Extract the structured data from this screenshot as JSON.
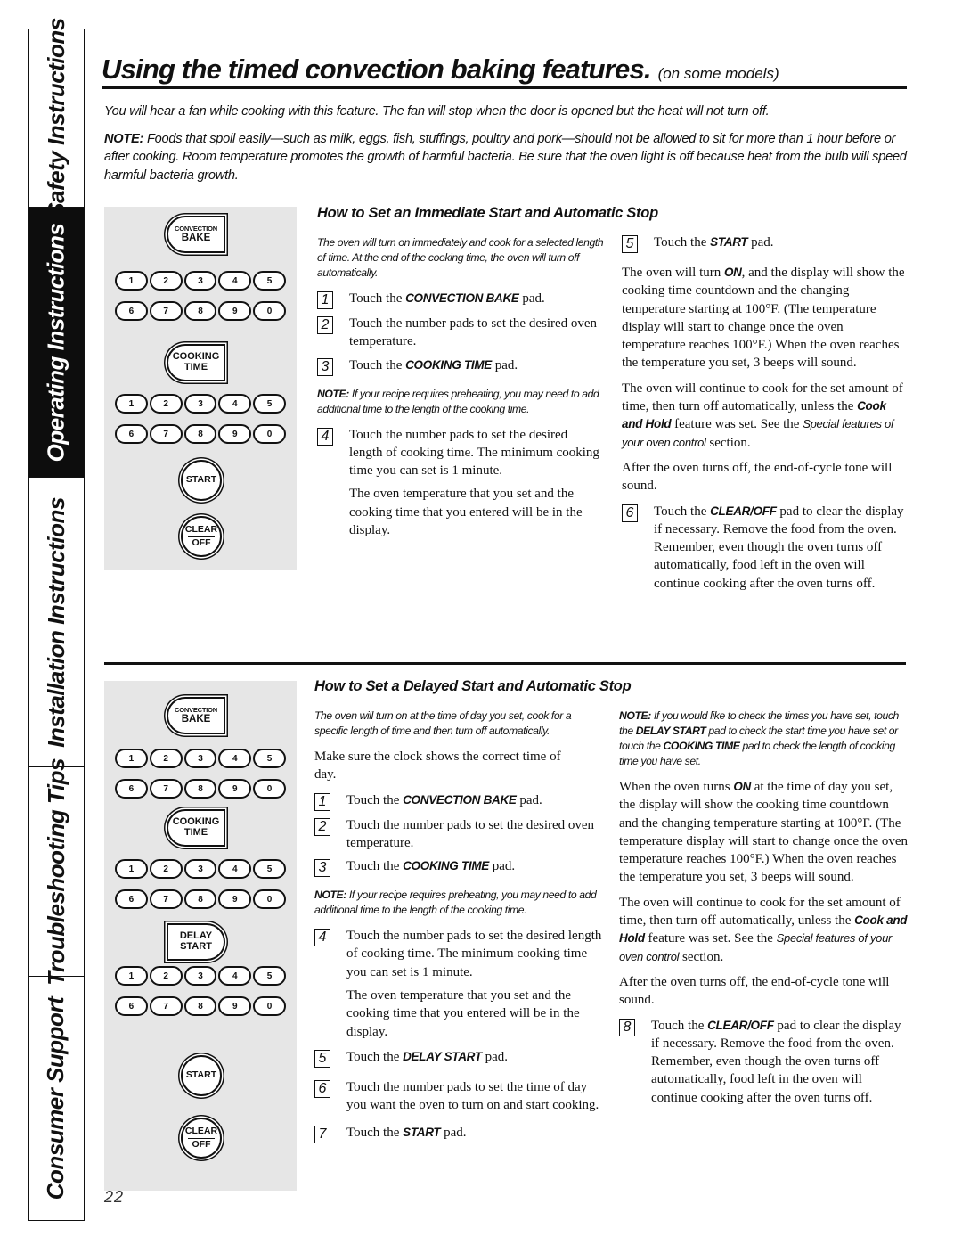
{
  "side_tabs": [
    {
      "label": "Safety Instructions",
      "active": false
    },
    {
      "label": "Operating Instructions",
      "active": true
    },
    {
      "label": "Installation Instructions",
      "active": false
    },
    {
      "label": "Troubleshooting Tips",
      "active": false
    },
    {
      "label": "Consumer Support",
      "active": false
    }
  ],
  "header": {
    "title": "Using the timed convection baking features.",
    "subtitle": "(on some models)"
  },
  "intro": {
    "fan_note": "You will hear a fan while cooking with this feature. The fan will stop when the door is opened but the heat will not turn off.",
    "note_label": "NOTE:",
    "note_text": " Foods that spoil easily—such as milk, eggs, fish, stuffings, poultry and pork—should not be allowed to sit for more than 1 hour before or after cooking. Room temperature promotes the growth of harmful bacteria. Be sure that the oven light is off because heat from the bulb will speed harmful bacteria growth."
  },
  "keypad": {
    "convection_small": "CONVECTION",
    "convection_big": "BAKE",
    "cooking_line1": "COOKING",
    "cooking_line2": "TIME",
    "delay_line1": "DELAY",
    "delay_line2": "START",
    "row1": [
      "1",
      "2",
      "3",
      "4",
      "5"
    ],
    "row2": [
      "6",
      "7",
      "8",
      "9",
      "0"
    ],
    "start": "START",
    "clear_line1": "CLEAR",
    "clear_line2": "OFF"
  },
  "immediate": {
    "heading": "How to Set an Immediate Start and Automatic Stop",
    "lead": "The oven will turn on immediately and cook for a selected length of time. At the end of the cooking time, the oven will turn off automatically.",
    "step1": {
      "num": "1",
      "pre": "Touch the ",
      "kw": "CONVECTION BAKE",
      "post": " pad."
    },
    "step2": {
      "num": "2",
      "text": "Touch the number pads to set the desired oven temperature."
    },
    "step3": {
      "num": "3",
      "pre": "Touch the ",
      "kw": "COOKING TIME",
      "post": " pad."
    },
    "note_label": "NOTE:",
    "note_text": " If your recipe requires preheating, you may need to add additional time to the length of the cooking time.",
    "step4": {
      "num": "4",
      "text": "Touch the number pads to set the desired length of cooking time. The minimum cooking time you can set is 1 minute."
    },
    "step4_extra": "The oven temperature that you set and the cooking time that you entered will be in the display.",
    "step5": {
      "num": "5",
      "pre": "Touch the ",
      "kw": "START",
      "post": " pad."
    },
    "on_para": {
      "pre": "The oven will turn ",
      "kw": "ON",
      "post": ", and the display will show the cooking time countdown and the changing temperature starting at 100°F. (The temperature display will start to change once the oven temperature reaches 100°F.) When the oven reaches the temperature you set, 3 beeps will sound."
    },
    "continue_para": {
      "pre": "The oven will continue to cook for the set amount of time, then turn off automatically, unless the ",
      "kw": "Cook and Hold",
      "mid": " feature was set. See the ",
      "ital": "Special features of your oven control",
      "post": " section."
    },
    "after_para": "After the oven turns off, the end-of-cycle tone will sound.",
    "step6": {
      "num": "6",
      "pre": "Touch the ",
      "kw": "CLEAR/OFF",
      "post": " pad to clear the display if necessary. Remove the food from the oven. Remember, even though the oven turns off automatically, food left in the oven will continue cooking after the oven turns off."
    }
  },
  "delayed": {
    "heading": "How to Set a Delayed Start and Automatic Stop",
    "lead": "The oven will turn on at the time of day you set, cook for a specific length of time and then turn off automatically.",
    "clock_para": "Make sure the clock shows the correct time of day.",
    "step1": {
      "num": "1",
      "pre": "Touch the ",
      "kw": "CONVECTION BAKE",
      "post": " pad."
    },
    "step2": {
      "num": "2",
      "text": "Touch the number pads to set the desired oven temperature."
    },
    "step3": {
      "num": "3",
      "pre": "Touch the ",
      "kw": "COOKING TIME",
      "post": " pad."
    },
    "note_label": "NOTE:",
    "note_text": " If your recipe requires preheating, you may need to add additional time to the length of the cooking time.",
    "step4": {
      "num": "4",
      "text": "Touch the number pads to set the desired length of cooking time. The minimum cooking time you can set is 1 minute."
    },
    "step4_extra": "The oven temperature that you set and the cooking time that you entered will be in the display.",
    "step5": {
      "num": "5",
      "pre": "Touch the ",
      "kw": "DELAY START",
      "post": " pad."
    },
    "step6": {
      "num": "6",
      "text": "Touch the number pads to set the time of day you want the oven to turn on and start cooking."
    },
    "step7": {
      "num": "7",
      "pre": "Touch the ",
      "kw": "START",
      "post": " pad."
    },
    "check_note": {
      "label": "NOTE:",
      "t1": " If you would like to check the times you have set, touch the ",
      "kw1": "DELAY START",
      "t2": " pad to check the start time you have set or touch the ",
      "kw2": "COOKING TIME",
      "t3": " pad to check the length of cooking time you have set."
    },
    "on_para": {
      "pre": "When the oven turns ",
      "kw": "ON",
      "post": " at the time of day you set, the display will show the cooking time countdown and the changing temperature starting at 100°F. (The temperature display will start to change once the oven temperature reaches 100°F.) When the oven reaches the temperature you set, 3 beeps will sound."
    },
    "continue_para": {
      "pre": "The oven will continue to cook for the set amount of time, then turn off automatically, unless the ",
      "kw": "Cook and Hold",
      "mid": " feature was set. See the ",
      "ital": "Special features of your oven control",
      "post": " section."
    },
    "after_para": "After the oven turns off, the end-of-cycle tone will sound.",
    "step8": {
      "num": "8",
      "pre": "Touch the ",
      "kw": "CLEAR/OFF",
      "post": " pad to clear the display if necessary. Remove the food from the oven. Remember, even though the oven turns off automatically, food left in the oven will continue cooking after the oven turns off."
    }
  },
  "page_number": "22"
}
